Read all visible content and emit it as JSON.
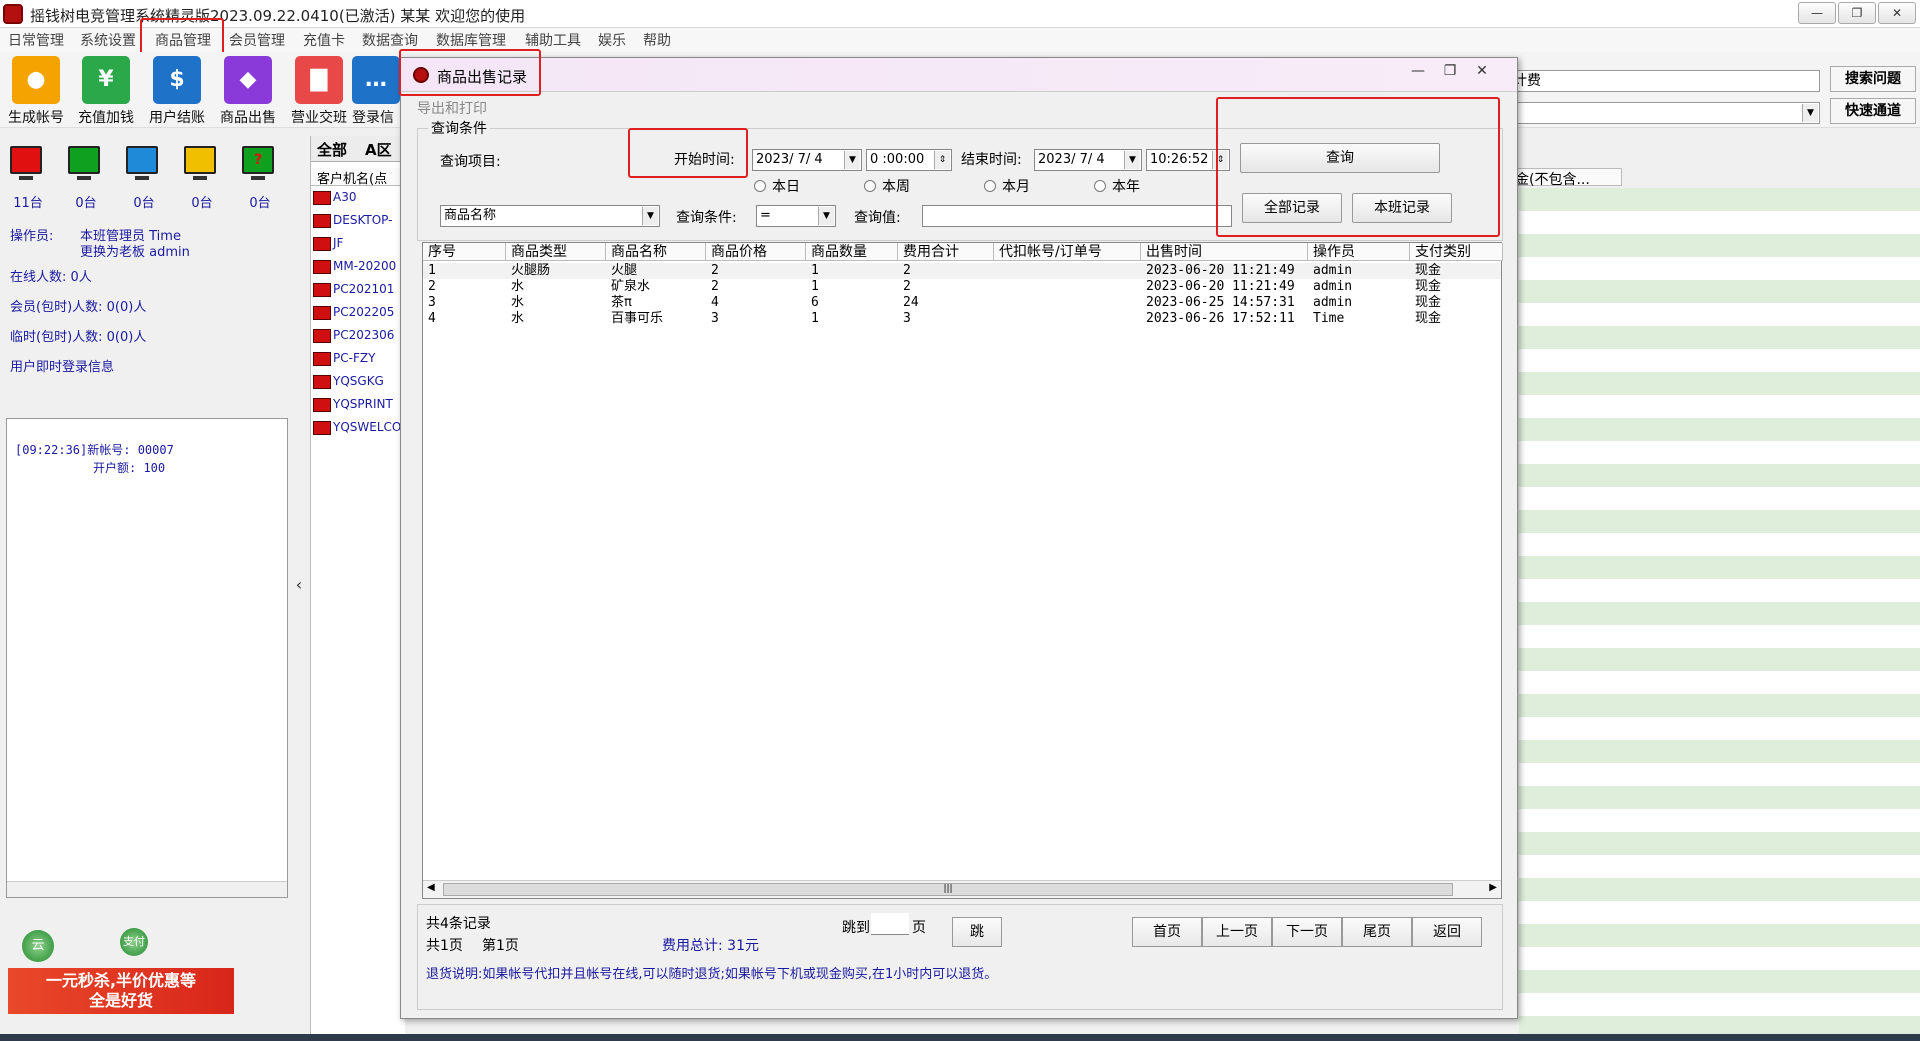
{
  "window": {
    "title": "摇钱树电竞管理系统精灵版2023.09.22.0410(已激活) 某某 欢迎您的使用",
    "controls": [
      "—",
      "❐",
      "✕"
    ]
  },
  "menu": [
    "日常管理",
    "系统设置",
    "商品管理",
    "会员管理",
    "充值卡",
    "数据查询",
    "数据库管理",
    "辅助工具",
    "娱乐",
    "帮助"
  ],
  "toolbar": [
    {
      "label": "生成帐号",
      "icon": "user-icon",
      "color": "#f5a300"
    },
    {
      "label": "充值加钱",
      "icon": "moneybag-icon",
      "color": "#2aa84a"
    },
    {
      "label": "用户结账",
      "icon": "bill-icon",
      "color": "#1e72c8"
    },
    {
      "label": "商品出售",
      "icon": "sale-tag-icon",
      "color": "#8a3ad8"
    },
    {
      "label": "营业交班",
      "icon": "shop-icon",
      "color": "#e84848"
    },
    {
      "label": "登录信",
      "icon": "chat-icon",
      "color": "#1e72c8"
    }
  ],
  "machine_status": [
    {
      "count": "11台",
      "color": "#e01010"
    },
    {
      "count": "0台",
      "color": "#10a020"
    },
    {
      "count": "0台",
      "color": "#1e8ad8"
    },
    {
      "count": "0台",
      "color": "#f0c000"
    },
    {
      "count": "0台",
      "color": "#10a020"
    }
  ],
  "left_info": {
    "operator_label": "操作员:",
    "operator_line1": "本班管理员 Time",
    "operator_line2": "更换为老板 admin",
    "online": "在线人数: 0人",
    "member_time": "会员(包时)人数: 0(0)人",
    "temp_time": "临时(包时)人数: 0(0)人",
    "login_info": "用户即时登录信息"
  },
  "log": {
    "line1": "[09:22:36]新帐号: 00007",
    "line2": "开户额: 100"
  },
  "bottom_icons": [
    "云",
    "支付"
  ],
  "promo": {
    "line1": "一元秒杀,半价优惠等",
    "line2": "全是好货"
  },
  "middle": {
    "tab_all": "全部",
    "tab_a": "A区",
    "column": "客户机名(点",
    "clients": [
      "A30",
      "DESKTOP-",
      "JF",
      "MM-20200",
      "PC202101",
      "PC202205",
      "PC202306",
      "PC-FZY",
      "YQSGKG",
      "YQSPRINT",
      "YQSWELCO"
    ]
  },
  "right": {
    "field1": "计费",
    "search_btn": "搜索问题",
    "quick_btn": "快速通道",
    "column": "金(不包含..."
  },
  "dialog": {
    "title": "商品出售记录",
    "menu": "导出和打印",
    "group_label": "查询条件",
    "query_item_label": "查询项目:",
    "start_label": "开始时间:",
    "start_date": "2023/ 7/ 4",
    "start_time": "0 :00:00",
    "end_label": "结束时间:",
    "end_date": "2023/ 7/ 4",
    "end_time": "10:26:52",
    "query_btn": "查询",
    "radios": [
      "本日",
      "本周",
      "本月",
      "本年"
    ],
    "item_select": "商品名称",
    "condition_label": "查询条件:",
    "condition_value": "=",
    "value_label": "查询值:",
    "value": "",
    "all_btn": "全部记录",
    "shift_btn": "本班记录",
    "table": {
      "headers": [
        "序号",
        "商品类型",
        "商品名称",
        "商品价格",
        "商品数量",
        "费用合计",
        "代扣帐号/订单号",
        "出售时间",
        "操作员",
        "支付类别"
      ],
      "rows": [
        [
          "1",
          "火腿肠",
          "火腿",
          "2",
          "1",
          "2",
          "",
          "2023-06-20 11:21:49",
          "admin",
          "现金"
        ],
        [
          "2",
          "水",
          "矿泉水",
          "2",
          "1",
          "2",
          "",
          "2023-06-20 11:21:49",
          "admin",
          "现金"
        ],
        [
          "3",
          "水",
          "茶π",
          "4",
          "6",
          "24",
          "",
          "2023-06-25 14:57:31",
          "admin",
          "现金"
        ],
        [
          "4",
          "水",
          "百事可乐",
          "3",
          "1",
          "3",
          "",
          "2023-06-26 17:52:11",
          "Time",
          "现金"
        ]
      ]
    },
    "footer": {
      "total_records": "共4条记录",
      "pages": "共1页",
      "current_page": "第1页",
      "fee_total": "费用总计: 31元",
      "jump_label": "跳到",
      "jump_value": "",
      "page_label": "页",
      "jump_btn": "跳",
      "first": "首页",
      "prev": "上一页",
      "next": "下一页",
      "last": "尾页",
      "back": "返回",
      "note": "退货说明:如果帐号代扣并且帐号在线,可以随时退货;如果帐号下机或现金购买,在1小时内可以退货。"
    }
  }
}
